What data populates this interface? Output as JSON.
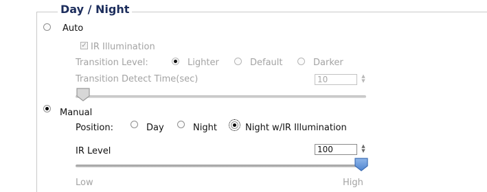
{
  "section_title": "Day / Night",
  "auto": {
    "label": "Auto",
    "ir_illumination_label": "IR Illumination",
    "transition_level_label": "Transition Level:",
    "levels": [
      "Lighter",
      "Default",
      "Darker"
    ],
    "selected_level": "Lighter",
    "detect_time_label": "Transition Detect Time(sec)",
    "detect_time_value": "10",
    "detect_time_fraction": 0.0
  },
  "manual": {
    "label": "Manual",
    "selected": true,
    "position_label": "Position:",
    "positions": [
      "Day",
      "Night",
      "Night w/IR Illumination"
    ],
    "selected_position": "Night w/IR Illumination",
    "ir_level_label": "IR Level",
    "ir_level_value": "100",
    "ir_level_fraction": 1.0,
    "low_label": "Low",
    "high_label": "High"
  },
  "colors": {
    "legend": "#1c2d5c",
    "disabled_text": "#a3a3a3",
    "thumb_active": "#5a8fd6"
  }
}
